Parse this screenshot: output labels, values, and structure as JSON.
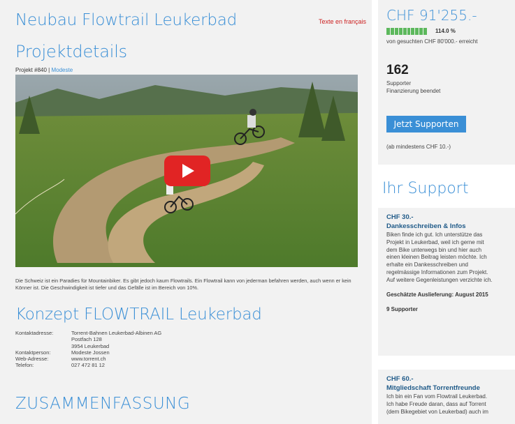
{
  "main": {
    "title": "Neubau Flowtrail Leukerbad",
    "lang_link": "Texte en français",
    "details_title": "Projektdetails",
    "project_prefix": "Projekt #840 |",
    "project_owner": "Modeste",
    "description": "Die Schweiz ist ein Paradies für Mountainbiker. Es gibt jedoch kaum Flowtrails. Ein Flowtrail kann von jederman befahren werden, auch wenn er kein Könner ist. Die Geschwindigkeit ist tiefer und das Gefälle ist im Bereich von 10%.",
    "concept_title": "Konzept  FLOWTRAIL Leukerbad",
    "contact": {
      "address_label": "Kontaktadresse:",
      "address_lines": [
        "Torrent-Bahnen Leukerbad-Albinen AG",
        "Postfach 128",
        "3954 Leukerbad"
      ],
      "person_label": "Kontaktperson:",
      "person": "Modeste Jossen",
      "web_label": "Web-Adresse:",
      "web": "www.torrent.ch",
      "phone_label": "Telefon:",
      "phone": "027 472 81 12"
    },
    "summary_title": "ZUSAMMENFASSUNG"
  },
  "funding": {
    "amount": "CHF 91'255.-",
    "percent_text": "114.0 %",
    "progress_fraction": 1.14,
    "goal": "von gesuchten CHF 80'000.- erreicht",
    "supporters": "162",
    "supporters_label": "Supporter",
    "status": "Finanzierung beendet",
    "button": "Jetzt Supporten",
    "min_note": "(ab mindestens CHF 10.-)"
  },
  "support_title": "Ihr Support",
  "rewards": [
    {
      "price": "CHF 30.-",
      "name": "Dankesschreiben & Infos",
      "lines": [
        "Biken finde ich gut. Ich unterstütze das",
        "Projekt in Leukerbad, weil ich gerne mit",
        "dem Bike unterwegs bin und hier auch",
        "einen kleinen Beitrag leisten möchte. Ich",
        "erhalte ein Dankesschreiben und",
        "regelmässige Informationen zum Projekt.",
        "Auf weitere Gegenleistungen verzichte ich."
      ],
      "delivery": "Geschätzte Auslieferung: August 2015",
      "supporters": "9 Supporter"
    },
    {
      "price": "CHF 60.-",
      "name": "Mitgliedschaft Torrentfreunde",
      "lines": [
        "Ich bin ein Fan vom Flowtrail Leukerbad.",
        "Ich habe Freude daran, dass auf Torrent",
        "(dem Bikegebiet von Leukerbad) auch im"
      ]
    }
  ],
  "colors": {
    "accent": "#3a8fd6",
    "progress": "#5cb85c",
    "play": "#e12424",
    "link_red": "#cc2222"
  },
  "icons": {
    "video_play": "play-icon"
  }
}
